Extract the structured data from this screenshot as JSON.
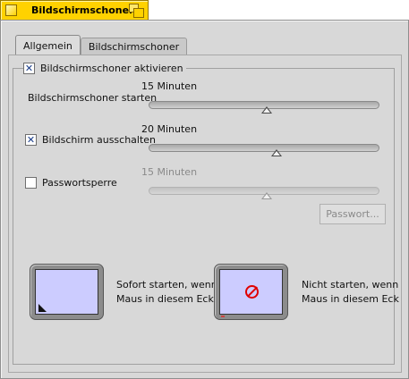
{
  "window": {
    "title": "Bildschirmschoner",
    "accent_color": "#ffd200"
  },
  "tabs": [
    {
      "label": "Allgemein",
      "active": true
    },
    {
      "label": "Bildschirmschoner",
      "active": false
    }
  ],
  "enable_checkbox": {
    "label": "Bildschirmschoner aktivieren",
    "checked": true
  },
  "start": {
    "label": "Bildschirmschoner starten",
    "value_text": "15 Minuten",
    "slider_fraction": 0.5
  },
  "screen_off": {
    "label": "Bildschirm ausschalten",
    "checked": true,
    "value_text": "20 Minuten",
    "slider_fraction": 0.55
  },
  "password": {
    "label": "Passwortsperre",
    "checked": false,
    "value_text": "15 Minuten",
    "slider_fraction": 0.5,
    "button_label": "Passwort..."
  },
  "corners": {
    "start_now": {
      "line1": "Sofort starten, wenn",
      "line2": "Maus in diesem Eck"
    },
    "never_start": {
      "line1": "Nicht starten, wenn",
      "line2": "Maus in diesem Eck"
    },
    "screen_color": "#ccccff",
    "no_icon_color": "#e00000"
  }
}
